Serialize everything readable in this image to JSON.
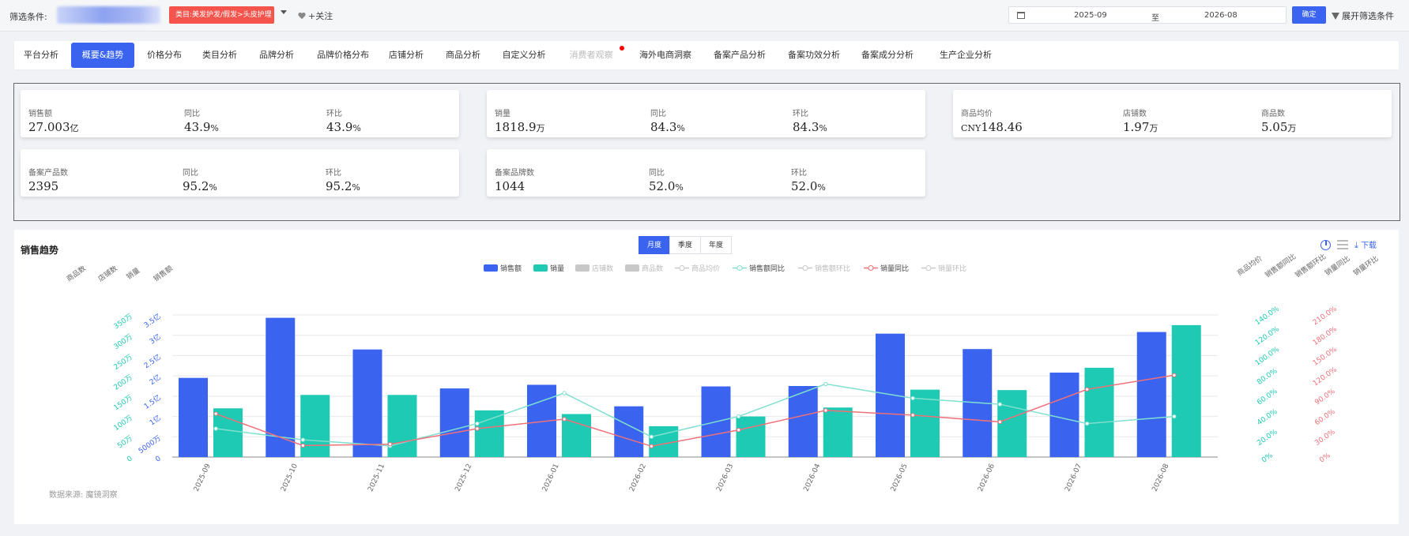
{
  "filter": {
    "label": "筛选条件:",
    "category_tag": "类目:美发护发/假发>头皮护理",
    "follow": "+关注",
    "date_start": "2025-09",
    "date_sep": "至",
    "date_end": "2026-08",
    "confirm": "确定",
    "expand": "展开筛选条件"
  },
  "tabs": [
    {
      "label": "平台分析"
    },
    {
      "label": "概要&趋势",
      "active": true
    },
    {
      "label": "价格分布"
    },
    {
      "label": "类目分析"
    },
    {
      "label": "品牌分析"
    },
    {
      "label": "品牌价格分布"
    },
    {
      "label": "店铺分析"
    },
    {
      "label": "商品分析"
    },
    {
      "label": "自定义分析"
    },
    {
      "label": "消费者观察",
      "disabled": true,
      "dot": true
    },
    {
      "label": "海外电商洞察"
    },
    {
      "label": "备案产品分析"
    },
    {
      "label": "备案功效分析"
    },
    {
      "label": "备案成分分析"
    },
    {
      "label": "生产企业分析"
    }
  ],
  "kpi": {
    "sales_amount": {
      "label": "销售额",
      "value": "27.003",
      "unit": "亿"
    },
    "sales_amount_yoy": {
      "label": "同比",
      "value": "43.9",
      "unit": "%"
    },
    "sales_amount_mom": {
      "label": "环比",
      "value": "43.9",
      "unit": "%"
    },
    "sales_volume": {
      "label": "销量",
      "value": "1818.9",
      "unit": "万"
    },
    "sales_volume_yoy": {
      "label": "同比",
      "value": "84.3",
      "unit": "%"
    },
    "sales_volume_mom": {
      "label": "环比",
      "value": "84.3",
      "unit": "%"
    },
    "avg_price": {
      "label": "商品均价",
      "prefix": "CNY",
      "value": "148.46"
    },
    "shops": {
      "label": "店铺数",
      "value": "1.97",
      "unit": "万"
    },
    "products": {
      "label": "商品数",
      "value": "5.05",
      "unit": "万"
    },
    "registered_products": {
      "label": "备案产品数",
      "value": "2395"
    },
    "registered_products_yoy": {
      "label": "同比",
      "value": "95.2",
      "unit": "%"
    },
    "registered_products_mom": {
      "label": "环比",
      "value": "95.2",
      "unit": "%"
    },
    "registered_brands": {
      "label": "备案品牌数",
      "value": "1044"
    },
    "registered_brands_yoy": {
      "label": "同比",
      "value": "52.0",
      "unit": "%"
    },
    "registered_brands_mom": {
      "label": "环比",
      "value": "52.0",
      "unit": "%"
    }
  },
  "chart_panel": {
    "title": "销售趋势",
    "periods": [
      "月度",
      "季度",
      "年度"
    ],
    "active_period": "月度",
    "download": "下载",
    "source": "数据来源: 魔镜洞察"
  },
  "colors": {
    "accent": "#3a64f0",
    "sales_amount": "#3a64f0",
    "sales_volume": "#1ecab3",
    "sales_amount_yoy": "#7fe0d0",
    "sales_volume_yoy": "#f0707a",
    "legend_disabled": "#c8c8c8"
  },
  "chart_data": {
    "type": "bar",
    "categories": [
      "2025-09",
      "2025-10",
      "2025-11",
      "2025-12",
      "2026-01",
      "2026-02",
      "2026-03",
      "2026-04",
      "2026-05",
      "2026-06",
      "2026-07",
      "2026-08"
    ],
    "series": [
      {
        "name": "销售额",
        "unit": "亿",
        "axis": "left-amount",
        "kind": "bar",
        "values": [
          1.95,
          3.43,
          2.65,
          1.69,
          1.78,
          1.25,
          1.74,
          1.75,
          3.04,
          2.66,
          2.08,
          3.08
        ]
      },
      {
        "name": "销量",
        "unit": "万",
        "axis": "left-volume",
        "kind": "bar",
        "values": [
          120,
          153,
          153,
          115,
          106,
          76,
          100,
          122,
          166,
          165,
          220,
          325
        ]
      },
      {
        "name": "店铺数",
        "kind": "bar",
        "hidden": true,
        "values": []
      },
      {
        "name": "商品数",
        "kind": "bar",
        "hidden": true,
        "values": []
      },
      {
        "name": "商品均价",
        "kind": "line",
        "hidden": true,
        "values": []
      },
      {
        "name": "销售额同比",
        "unit": "%",
        "axis": "right-amount-pct",
        "kind": "line",
        "values": [
          28,
          17,
          11,
          33,
          63,
          20,
          40,
          72,
          58,
          52,
          33,
          40
        ]
      },
      {
        "name": "销售额环比",
        "kind": "line",
        "hidden": true,
        "values": []
      },
      {
        "name": "销量同比",
        "unit": "%",
        "axis": "right-volume-pct",
        "kind": "line",
        "values": [
          64,
          17,
          19,
          42,
          56,
          16,
          40,
          69,
          62,
          52,
          100,
          121
        ]
      },
      {
        "name": "销量环比",
        "kind": "line",
        "hidden": true,
        "values": []
      }
    ],
    "axes": {
      "left_amount": {
        "name": "销售额",
        "ticks": [
          "0",
          "5000万",
          "1亿",
          "1.5亿",
          "2亿",
          "2.5亿",
          "3亿",
          "3.5亿"
        ],
        "range": [
          0,
          3.5
        ]
      },
      "left_volume": {
        "name": "销量",
        "ticks": [
          "0",
          "50万",
          "100万",
          "150万",
          "200万",
          "250万",
          "300万",
          "350万"
        ],
        "range": [
          0,
          350
        ]
      },
      "left_shops": {
        "name": "店铺数"
      },
      "left_products": {
        "name": "商品数"
      },
      "right_price": {
        "name": "商品均价"
      },
      "right_amount_yoy": {
        "name": "销售额同比",
        "ticks": [
          "0%",
          "20.0%",
          "40.0%",
          "60.0%",
          "80.0%",
          "100.0%",
          "120.0%",
          "140.0%"
        ],
        "range": [
          0,
          140
        ]
      },
      "right_amount_mom": {
        "name": "销售额环比"
      },
      "right_volume_yoy": {
        "name": "销量同比",
        "ticks": [
          "0%",
          "30.0%",
          "60.0%",
          "90.0%",
          "120.0%",
          "150.0%",
          "180.0%",
          "210.0%"
        ],
        "range": [
          0,
          210
        ]
      },
      "right_volume_mom": {
        "name": "销量环比"
      }
    },
    "legend_position": "top-center",
    "grid": "horizontal"
  }
}
